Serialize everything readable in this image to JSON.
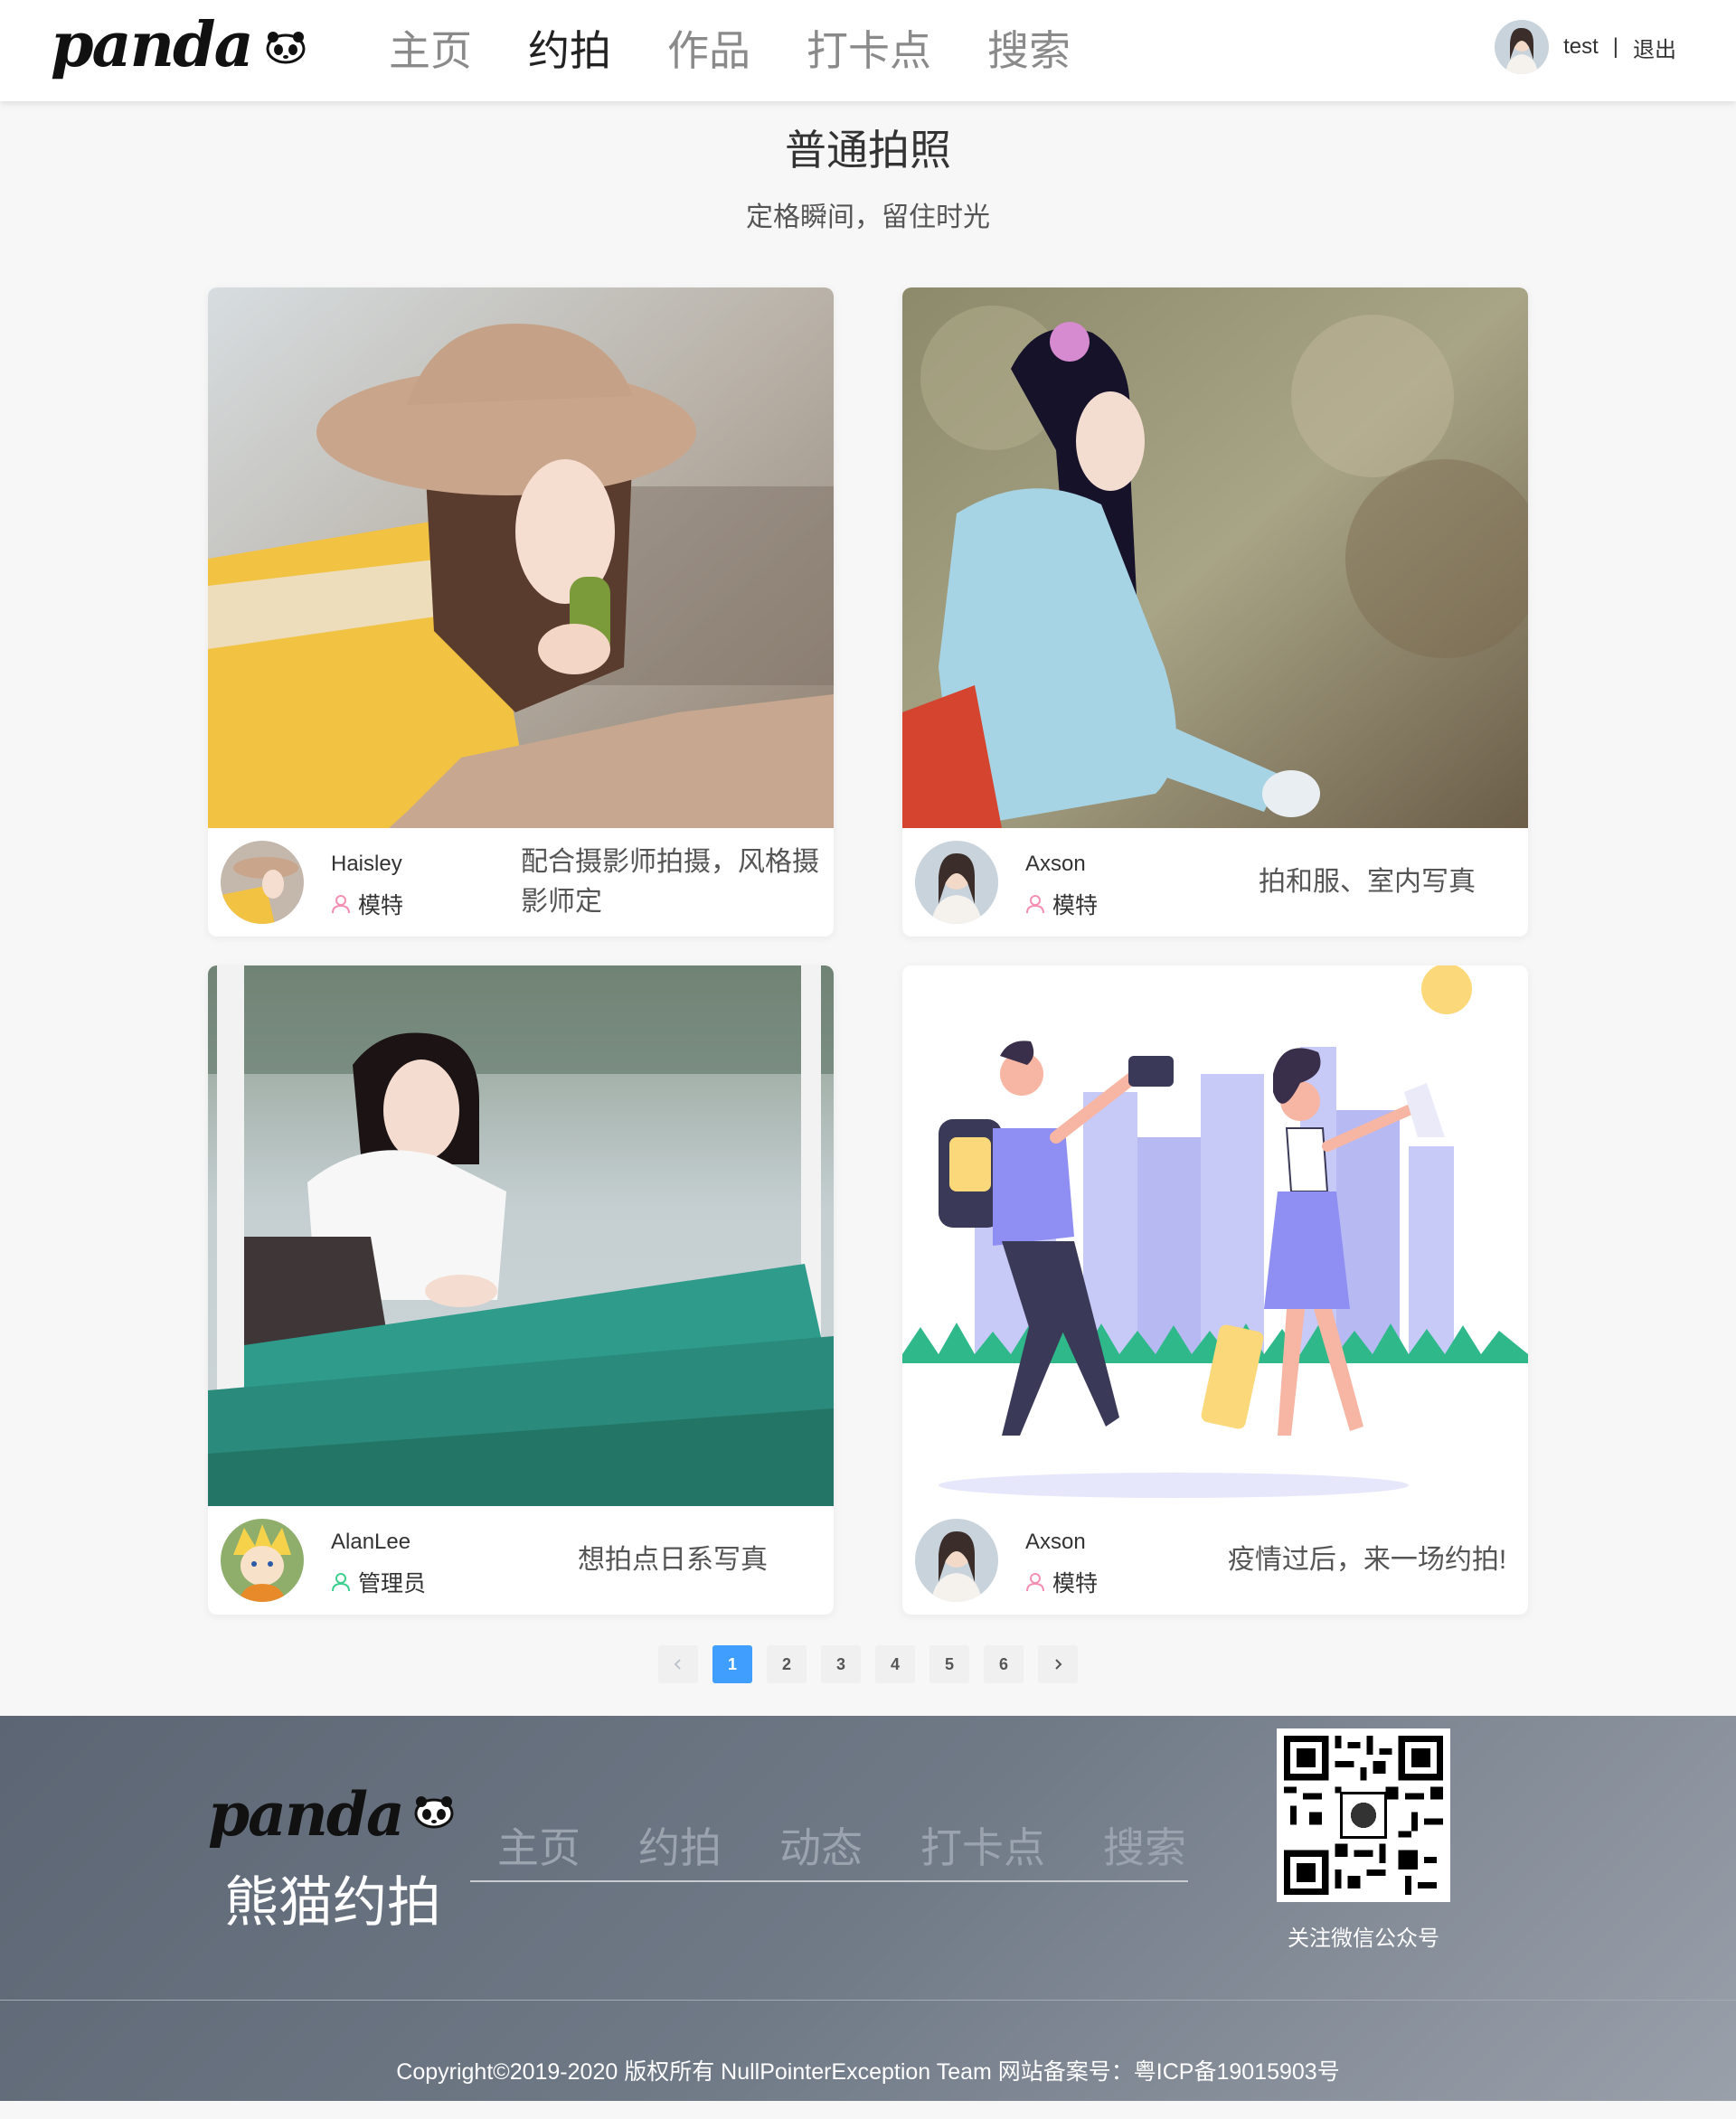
{
  "header": {
    "logo_text": "panda",
    "nav": [
      {
        "label": "主页",
        "active": false
      },
      {
        "label": "约拍",
        "active": true
      },
      {
        "label": "作品",
        "active": false
      },
      {
        "label": "打卡点",
        "active": false
      },
      {
        "label": "搜索",
        "active": false
      }
    ],
    "user": {
      "name": "test",
      "separator": "|",
      "logout_label": "退出"
    }
  },
  "main": {
    "title": "普通拍照",
    "subtitle": "定格瞬间，留住时光",
    "cards": [
      {
        "author": "Haisley",
        "role": "模特",
        "role_color": "#f48fb1",
        "description": "配合摄影师拍摄，风格摄影师定"
      },
      {
        "author": "Axson",
        "role": "模特",
        "role_color": "#f48fb1",
        "description": "拍和服、室内写真"
      },
      {
        "author": "AlanLee",
        "role": "管理员",
        "role_color": "#3ecf8e",
        "description": "想拍点日系写真"
      },
      {
        "author": "Axson",
        "role": "模特",
        "role_color": "#f48fb1",
        "description": "疫情过后，来一场约拍!"
      }
    ]
  },
  "pagination": {
    "prev_icon": "chevron-left-icon",
    "next_icon": "chevron-right-icon",
    "pages": [
      "1",
      "2",
      "3",
      "4",
      "5",
      "6"
    ],
    "current": "1"
  },
  "footer": {
    "logo_text": "panda",
    "brand": "熊猫约拍",
    "nav": [
      "主页",
      "约拍",
      "动态",
      "打卡点",
      "搜索"
    ],
    "qr_label": "关注微信公众号",
    "copyright": "Copyright©2019-2020 版权所有 NullPointerException Team 网站备案号：粤ICP备19015903号"
  },
  "colors": {
    "accent": "#409eff",
    "footer_start": "#5b6573",
    "footer_end": "#9aa0aa"
  }
}
